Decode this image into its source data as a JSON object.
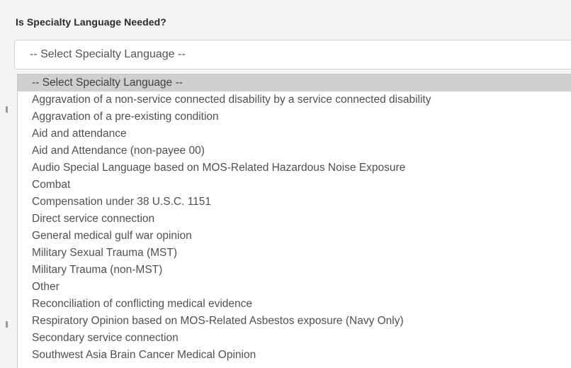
{
  "field": {
    "label": "Is Specialty Language Needed?",
    "selected_value": "-- Select Specialty Language --"
  },
  "dropdown": {
    "highlighted_index": 0,
    "options": [
      "-- Select Specialty Language --",
      "Aggravation of a non-service connected disability by a service connected disability",
      "Aggravation of a pre-existing condition",
      "Aid and attendance",
      "Aid and Attendance (non-payee 00)",
      "Audio Special Language based on MOS-Related Hazardous Noise Exposure",
      "Combat",
      "Compensation under 38 U.S.C. 1151",
      "Direct service connection",
      "General medical gulf war opinion",
      "Military Sexual Trauma (MST)",
      "Military Trauma (non-MST)",
      "Other",
      "Reconciliation of conflicting medical evidence",
      "Respiratory Opinion based on MOS-Related Asbestos exposure (Navy Only)",
      "Secondary service connection",
      "Southwest Asia Brain Cancer Medical Opinion"
    ]
  },
  "colors": {
    "highlight": "#cfcfcf",
    "option_text": "#505050",
    "label_text": "#2b2b2b"
  }
}
